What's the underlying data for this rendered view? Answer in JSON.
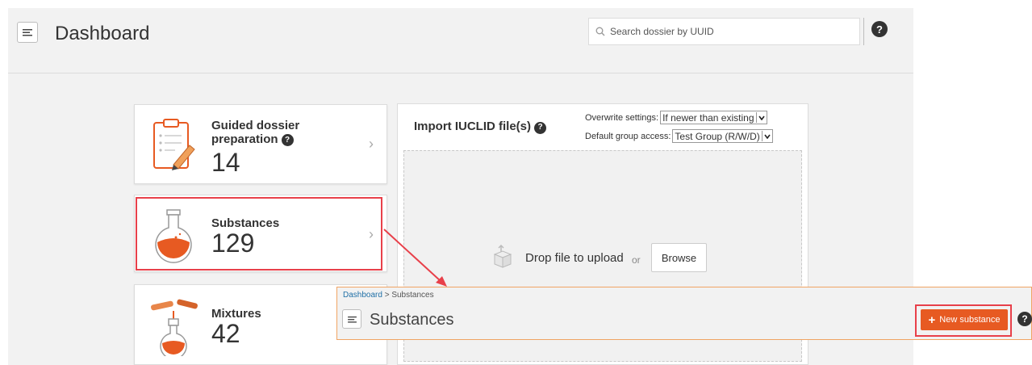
{
  "header": {
    "title": "Dashboard",
    "search_placeholder": "Search dossier by UUID",
    "help": "?"
  },
  "tiles": [
    {
      "title_line1": "Guided dossier",
      "title_line2": "preparation",
      "count": "14",
      "icon": "clipboard-icon"
    },
    {
      "title": "Substances",
      "count": "129",
      "icon": "flask-icon"
    },
    {
      "title": "Mixtures",
      "count": "42",
      "icon": "mixing-flasks-icon"
    }
  ],
  "import": {
    "title": "Import IUCLID file(s)",
    "overwrite_label": "Overwrite settings:",
    "overwrite_value": "If newer than existing",
    "group_label": "Default group access:",
    "group_value": "Test Group (R/W/D)",
    "drop_text": "Drop file to upload",
    "or": "or",
    "browse": "Browse"
  },
  "overlay": {
    "breadcrumb_root": "Dashboard",
    "breadcrumb_sep": " > ",
    "breadcrumb_current": "Substances",
    "title": "Substances",
    "new_button": "New substance",
    "help": "?"
  },
  "colors": {
    "accent": "#e75a22",
    "highlight": "#e8404a",
    "link": "#1f6fa6"
  }
}
